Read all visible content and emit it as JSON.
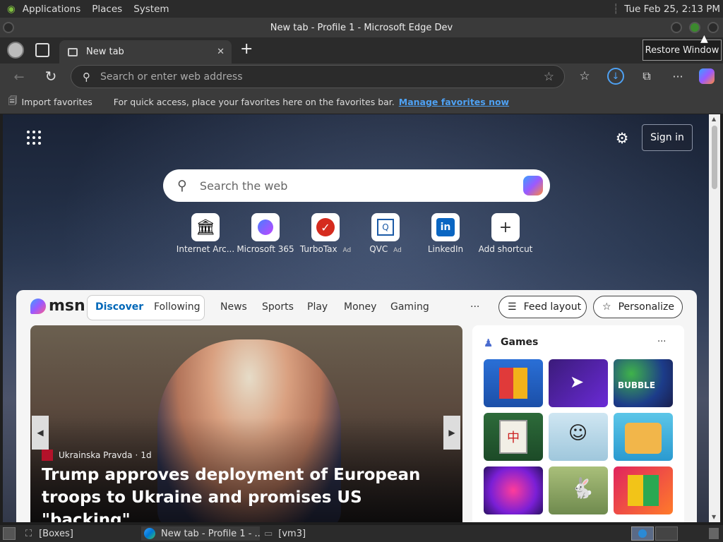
{
  "desktop": {
    "menu": [
      "Applications",
      "Places",
      "System"
    ],
    "clock": "Tue Feb 25,  2:13 PM"
  },
  "window": {
    "title": "New tab - Profile 1 - Microsoft Edge Dev",
    "tooltip": "Restore Window"
  },
  "tabs": {
    "active_label": "New tab",
    "new_tab": "+",
    "close": "✕"
  },
  "address": {
    "placeholder": "Search or enter web address"
  },
  "favorites": {
    "import_label": "Import favorites",
    "hint": "For quick access, place your favorites here on the favorites bar.",
    "manage_link": "Manage favorites now"
  },
  "newtab": {
    "sign_in": "Sign in",
    "search_placeholder": "Search the web",
    "shortcuts": [
      {
        "label": "Internet Arc...",
        "ad": ""
      },
      {
        "label": "Microsoft 365",
        "ad": ""
      },
      {
        "label": "TurboTax",
        "ad": "Ad"
      },
      {
        "label": "QVC",
        "ad": "Ad"
      },
      {
        "label": "LinkedIn",
        "ad": ""
      },
      {
        "label": "Add shortcut",
        "ad": ""
      }
    ]
  },
  "msn": {
    "logo": "msn",
    "tabs": [
      "Discover",
      "Following"
    ],
    "links": [
      "News",
      "Sports",
      "Play",
      "Money",
      "Gaming"
    ],
    "more": "···",
    "feed_layout": "Feed layout",
    "personalize": "Personalize",
    "hero": {
      "source": "Ukrainska Pravda",
      "age": "1d",
      "headline": "Trump approves deployment of European troops to Ukraine and promises US \"backing\""
    },
    "games": {
      "title": "Games",
      "more": "···"
    }
  },
  "taskbar": {
    "items": [
      "[Boxes]",
      "New tab - Profile 1 - ...",
      "[vm3]"
    ]
  },
  "colors": {
    "edge_accent": "#0078d4",
    "link": "#4ea1f3",
    "msn_active": "#0067b8"
  }
}
